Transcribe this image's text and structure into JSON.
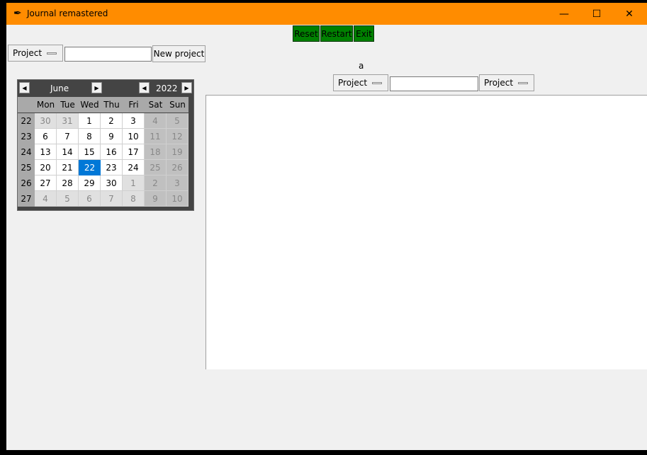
{
  "window": {
    "title": "Journal remastered",
    "icon": "feather-icon",
    "titlebar_color": "#ff8c00",
    "controls": {
      "minimize": "—",
      "maximize": "☐",
      "close": "✕"
    }
  },
  "toolbar": {
    "reset": "Reset",
    "restart": "Restart",
    "exit": "Exit",
    "button_color": "#008000"
  },
  "left_panel": {
    "project_menu": "Project",
    "project_entry": "",
    "new_project": "New project"
  },
  "calendar": {
    "month": "June",
    "year": "2022",
    "day_names": [
      "Mon",
      "Tue",
      "Wed",
      "Thu",
      "Fri",
      "Sat",
      "Sun"
    ],
    "weeks": [
      {
        "num": "22",
        "days": [
          "30",
          "31",
          "1",
          "2",
          "3",
          "4",
          "5"
        ]
      },
      {
        "num": "23",
        "days": [
          "6",
          "7",
          "8",
          "9",
          "10",
          "11",
          "12"
        ]
      },
      {
        "num": "24",
        "days": [
          "13",
          "14",
          "15",
          "16",
          "17",
          "18",
          "19"
        ]
      },
      {
        "num": "25",
        "days": [
          "20",
          "21",
          "22",
          "23",
          "24",
          "25",
          "26"
        ]
      },
      {
        "num": "26",
        "days": [
          "27",
          "28",
          "29",
          "30",
          "1",
          "2",
          "3"
        ]
      },
      {
        "num": "27",
        "days": [
          "4",
          "5",
          "6",
          "7",
          "8",
          "9",
          "10"
        ]
      }
    ],
    "selected_day": "22",
    "selected_color": "#0078d7"
  },
  "right_panel": {
    "label": "a",
    "project_menu_1": "Project",
    "entry": "",
    "project_menu_2": "Project",
    "text_content": ""
  }
}
